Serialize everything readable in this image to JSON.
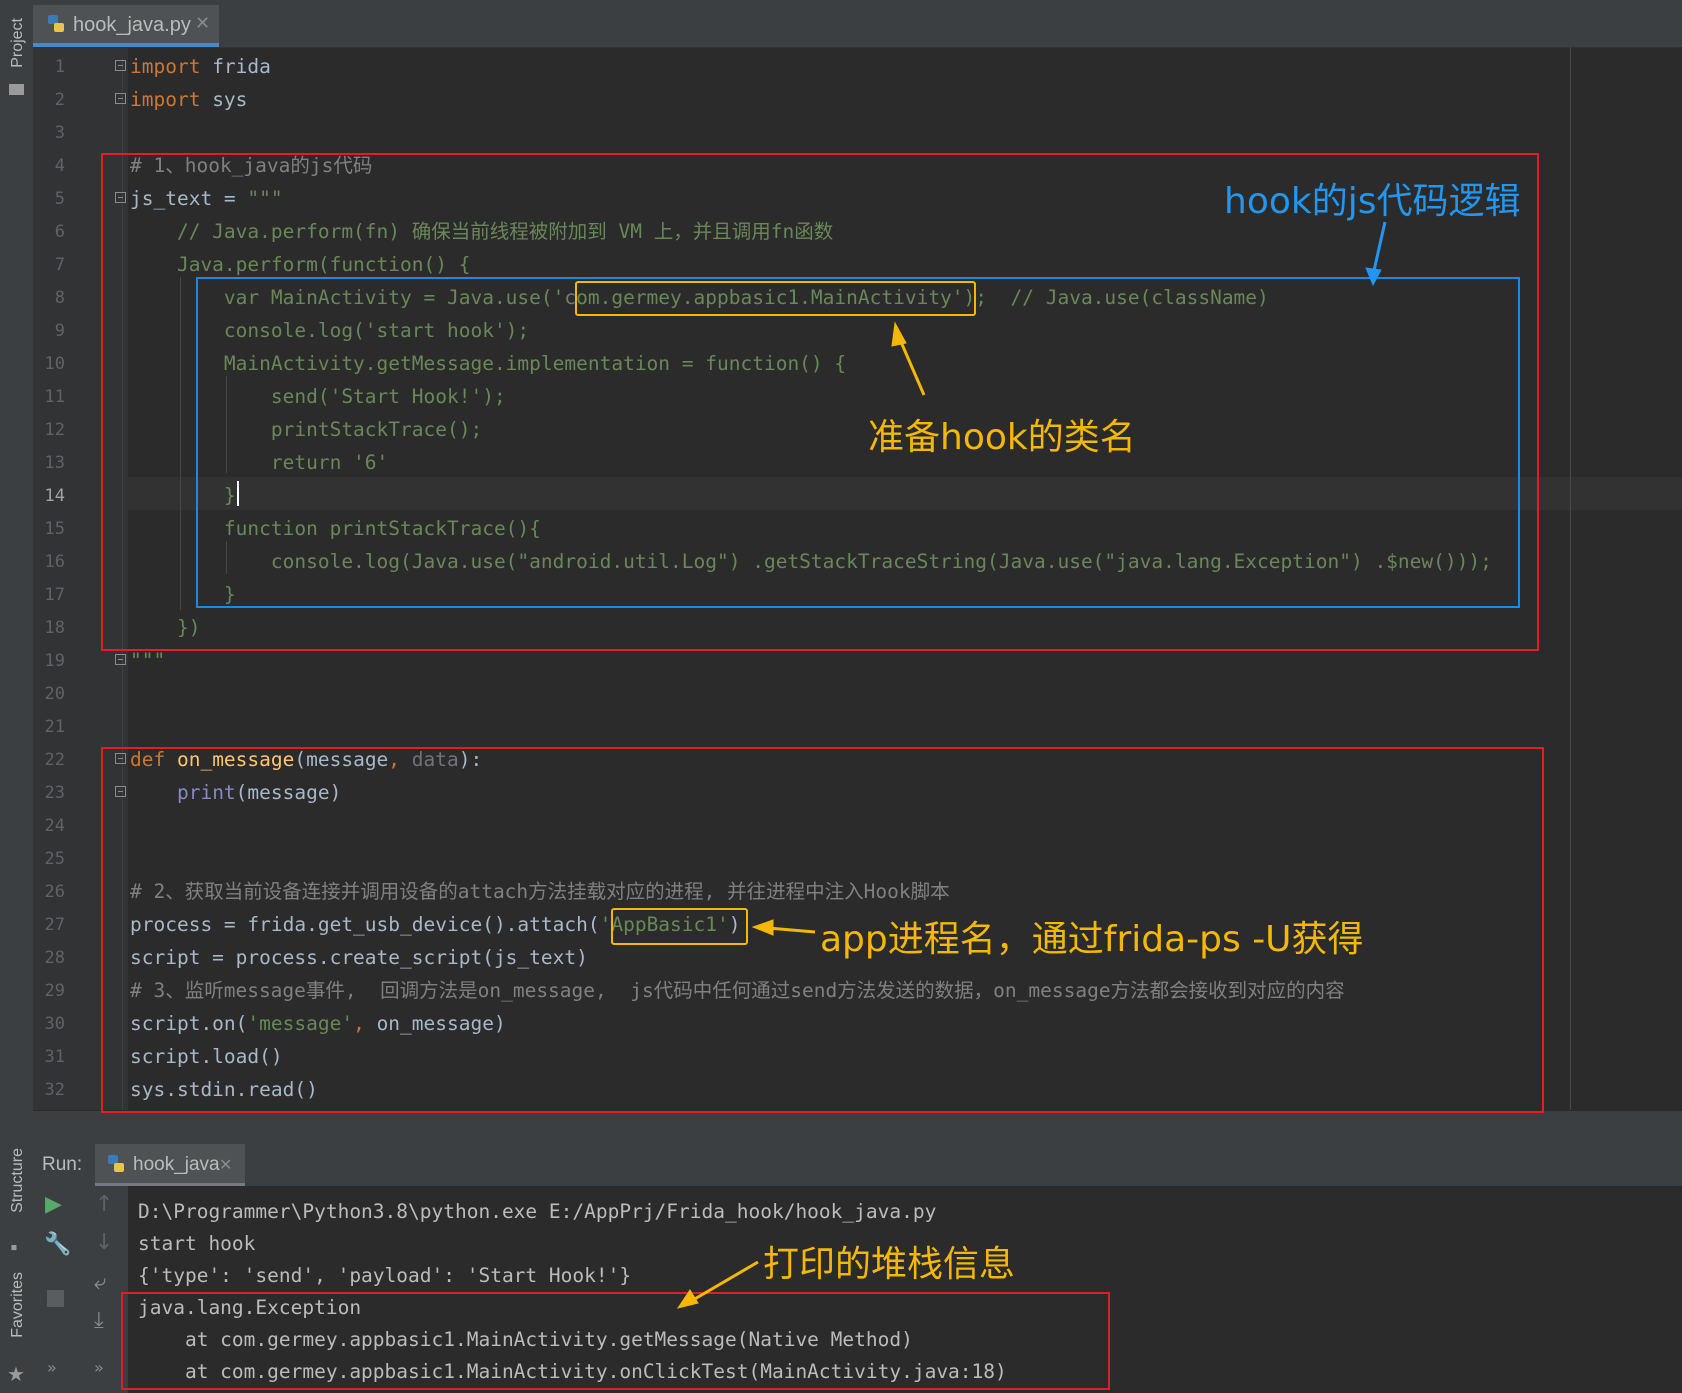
{
  "sidebar": {
    "project_label": "Project",
    "structure_label": "Structure",
    "favorites_label": "Favorites"
  },
  "tab": {
    "file_name": "hook_java.py"
  },
  "editor": {
    "lines": [
      {
        "n": "1",
        "segs": [
          [
            "kw",
            "import"
          ],
          [
            "",
            " frida"
          ]
        ]
      },
      {
        "n": "2",
        "segs": [
          [
            "kw",
            "import"
          ],
          [
            "",
            " sys"
          ]
        ]
      },
      {
        "n": "3",
        "segs": []
      },
      {
        "n": "4",
        "segs": [
          [
            "cm",
            "# 1、hook_java的js代码"
          ]
        ]
      },
      {
        "n": "5",
        "segs": [
          [
            "",
            "js_text = "
          ],
          [
            "str",
            "\"\"\""
          ]
        ]
      },
      {
        "n": "6",
        "segs": [
          [
            "jsc",
            "    // Java.perform(fn) 确保当前线程被附加到 VM 上，并且调用fn函数"
          ]
        ]
      },
      {
        "n": "7",
        "segs": [
          [
            "jsc",
            "    Java.perform(function() {"
          ]
        ]
      },
      {
        "n": "8",
        "segs": [
          [
            "jsc",
            "        var MainActivity = Java.use('com.germey.appbasic1.MainActivity');  // Java.use(className)"
          ]
        ]
      },
      {
        "n": "9",
        "segs": [
          [
            "jsc",
            "        console.log('start hook');"
          ]
        ]
      },
      {
        "n": "10",
        "segs": [
          [
            "jsc",
            "        MainActivity.getMessage.implementation = function() {"
          ]
        ]
      },
      {
        "n": "11",
        "segs": [
          [
            "jsc",
            "            send('Start Hook!');"
          ]
        ]
      },
      {
        "n": "12",
        "segs": [
          [
            "jsc",
            "            printStackTrace();"
          ]
        ]
      },
      {
        "n": "13",
        "segs": [
          [
            "jsc",
            "            return '6'"
          ]
        ]
      },
      {
        "n": "14",
        "segs": [
          [
            "jsc",
            "        }"
          ]
        ]
      },
      {
        "n": "15",
        "segs": [
          [
            "jsc",
            "        function printStackTrace(){"
          ]
        ]
      },
      {
        "n": "16",
        "segs": [
          [
            "jsc",
            "            console.log(Java.use(\"android.util.Log\") .getStackTraceString(Java.use(\"java.lang.Exception\") .$new()));"
          ]
        ]
      },
      {
        "n": "17",
        "segs": [
          [
            "jsc",
            "        }"
          ]
        ]
      },
      {
        "n": "18",
        "segs": [
          [
            "jsc",
            "    })"
          ]
        ]
      },
      {
        "n": "19",
        "segs": [
          [
            "str",
            "\"\"\""
          ]
        ]
      },
      {
        "n": "20",
        "segs": []
      },
      {
        "n": "21",
        "segs": []
      },
      {
        "n": "22",
        "segs": [
          [
            "kw",
            "def "
          ],
          [
            "fn",
            "on_message"
          ],
          [
            "",
            "(message"
          ],
          [
            "kw",
            ", "
          ],
          [
            "param",
            "data"
          ],
          [
            "",
            "):"
          ]
        ]
      },
      {
        "n": "23",
        "segs": [
          [
            "",
            "    "
          ],
          [
            "bi",
            "print"
          ],
          [
            "",
            "(message)"
          ]
        ]
      },
      {
        "n": "24",
        "segs": []
      },
      {
        "n": "25",
        "segs": []
      },
      {
        "n": "26",
        "segs": [
          [
            "cm",
            "# 2、获取当前设备连接并调用设备的attach方法挂载对应的进程, 并往进程中注入Hook脚本"
          ]
        ]
      },
      {
        "n": "27",
        "segs": [
          [
            "",
            "process = frida.get_usb_device().attach("
          ],
          [
            "str",
            "'AppBasic1'"
          ],
          [
            "",
            ")"
          ]
        ]
      },
      {
        "n": "28",
        "segs": [
          [
            "",
            "script = process.create_script(js_text)"
          ]
        ]
      },
      {
        "n": "29",
        "segs": [
          [
            "cm",
            "# 3、监听message事件,  回调方法是on_message,  js代码中任何通过send方法发送的数据，on_message方法都会接收到对应的内容"
          ]
        ]
      },
      {
        "n": "30",
        "segs": [
          [
            "",
            "script.on("
          ],
          [
            "str",
            "'message'"
          ],
          [
            "kw",
            ", "
          ],
          [
            "",
            "on_message)"
          ]
        ]
      },
      {
        "n": "31",
        "segs": [
          [
            "",
            "script.load()"
          ]
        ]
      },
      {
        "n": "32",
        "segs": [
          [
            "",
            "sys.stdin.read()"
          ]
        ]
      }
    ]
  },
  "run": {
    "label": "Run:",
    "tab_name": "hook_java",
    "console": [
      "D:\\Programmer\\Python3.8\\python.exe E:/AppPrj/Frida_hook/hook_java.py",
      "start hook",
      "{'type': 'send', 'payload': 'Start Hook!'}",
      "java.lang.Exception",
      "    at com.germey.appbasic1.MainActivity.getMessage(Native Method)",
      "    at com.germey.appbasic1.MainActivity.onClickTest(MainActivity.java:18)"
    ]
  },
  "annotations": {
    "hook_logic": "hook的js代码逻辑",
    "class_name": "准备hook的类名",
    "process_name": "app进程名，通过frida-ps -U获得",
    "stack_info": "打印的堆栈信息"
  }
}
